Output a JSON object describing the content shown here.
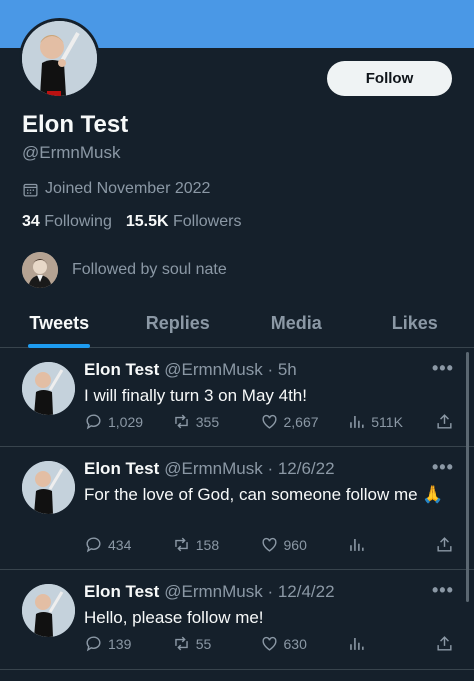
{
  "profile": {
    "name": "Elon Test",
    "handle": "@ErmnMusk",
    "joined": "Joined November 2022",
    "following_count": "34",
    "following_label": "Following",
    "followers_count": "15.5K",
    "followers_label": "Followers",
    "followed_by": "Followed by soul nate",
    "follow_label": "Follow"
  },
  "tabs": [
    {
      "label": "Tweets",
      "active": true
    },
    {
      "label": "Replies",
      "active": false
    },
    {
      "label": "Media",
      "active": false
    },
    {
      "label": "Likes",
      "active": false
    }
  ],
  "tweets": [
    {
      "name": "Elon Test",
      "meta": "@ErmnMusk · 5h",
      "text": "I will finally turn 3 on May 4th!",
      "replies": "1,029",
      "retweets": "355",
      "likes": "2,667",
      "views": "511K"
    },
    {
      "name": "Elon Test",
      "meta": "@ErmnMusk · 12/6/22",
      "text": "For the love of God, can someone follow me 🙏",
      "replies": "434",
      "retweets": "158",
      "likes": "960",
      "views": ""
    },
    {
      "name": "Elon Test",
      "meta": "@ErmnMusk · 12/4/22",
      "text": "Hello, please follow me!",
      "replies": "139",
      "retweets": "55",
      "likes": "630",
      "views": ""
    }
  ],
  "more_glyph": "•••",
  "colors": {
    "background": "#15202b",
    "banner": "#4a98e6",
    "accent": "#1d9bf0",
    "muted": "#8b98a5"
  }
}
